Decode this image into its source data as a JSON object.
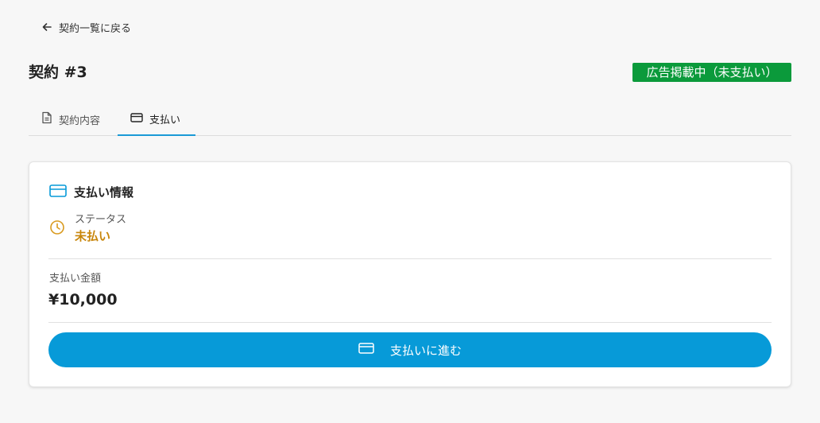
{
  "back_link": {
    "label": "契約一覧に戻る",
    "icon": "arrow-left-icon"
  },
  "header": {
    "title": "契約 #3",
    "status_badge": "広告掲載中（未支払い）",
    "status_color": "#0b9a3b"
  },
  "tabs": [
    {
      "label": "契約内容",
      "icon": "document-icon",
      "active": false
    },
    {
      "label": "支払い",
      "icon": "credit-card-icon",
      "active": true
    }
  ],
  "payment_card": {
    "title": "支払い情報",
    "title_icon": "credit-card-icon",
    "status_label": "ステータス",
    "status_value": "未払い",
    "status_icon": "clock-icon",
    "status_color": "#c8860b",
    "amount_label": "支払い金額",
    "amount_value": "¥10,000",
    "button_label": "支払いに進む",
    "button_icon": "credit-card-icon",
    "accent_color": "#079ad8"
  }
}
